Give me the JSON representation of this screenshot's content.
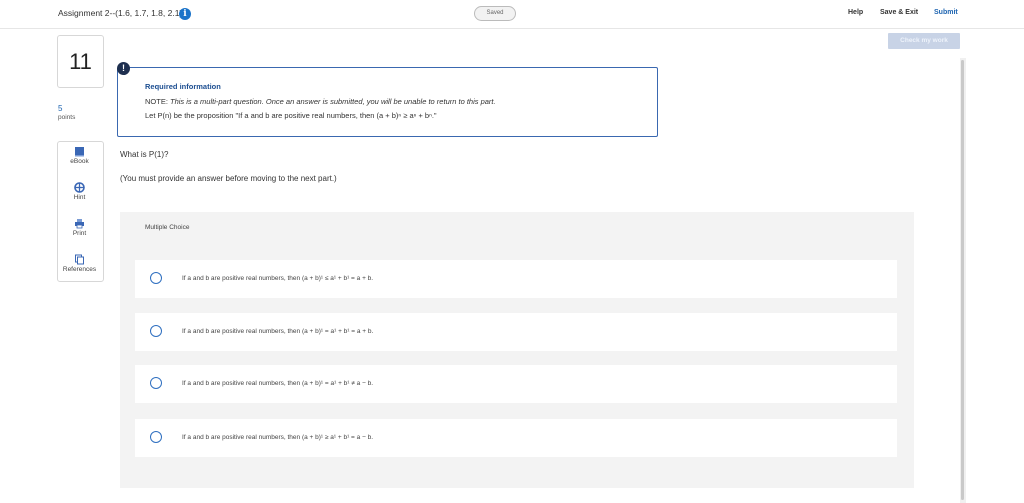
{
  "header": {
    "title": "Assignment 2--(1.6, 1.7, 1.8, 2.1)",
    "saved": "Saved",
    "help": "Help",
    "save_exit": "Save & Exit",
    "submit": "Submit",
    "check_work": "Check my work"
  },
  "question": {
    "number": "11",
    "points": "5",
    "points_label": "points"
  },
  "tools": [
    {
      "label": "eBook",
      "icon": "book-icon"
    },
    {
      "label": "Hint",
      "icon": "life-ring-icon"
    },
    {
      "label": "Print",
      "icon": "printer-icon"
    },
    {
      "label": "References",
      "icon": "documents-icon"
    }
  ],
  "required_info": {
    "title": "Required information",
    "note_prefix": "NOTE: ",
    "note_italic": "This is a multi-part question. Once an answer is submitted, you will be unable to return to this part.",
    "proposition": "Let P(n) be the proposition \"If a and b are positive real numbers, then (a + b)ⁿ ≥ aⁿ + bⁿ.\""
  },
  "prompt": {
    "text": "What is P(1)?",
    "note": "(You must provide an answer before moving to the next part.)"
  },
  "choices": {
    "label": "Multiple Choice",
    "options": [
      "If a and b are positive real numbers, then (a + b)¹ ≤ a¹ + b¹ = a + b.",
      "If a and b are positive real numbers, then (a + b)¹ = a¹ + b¹ = a + b.",
      "If a and b are positive real numbers, then (a + b)¹ = a¹ + b¹ ≠ a − b.",
      "If a and b are positive real numbers, then (a + b)¹ ≥ a¹ + b¹ = a − b."
    ]
  }
}
